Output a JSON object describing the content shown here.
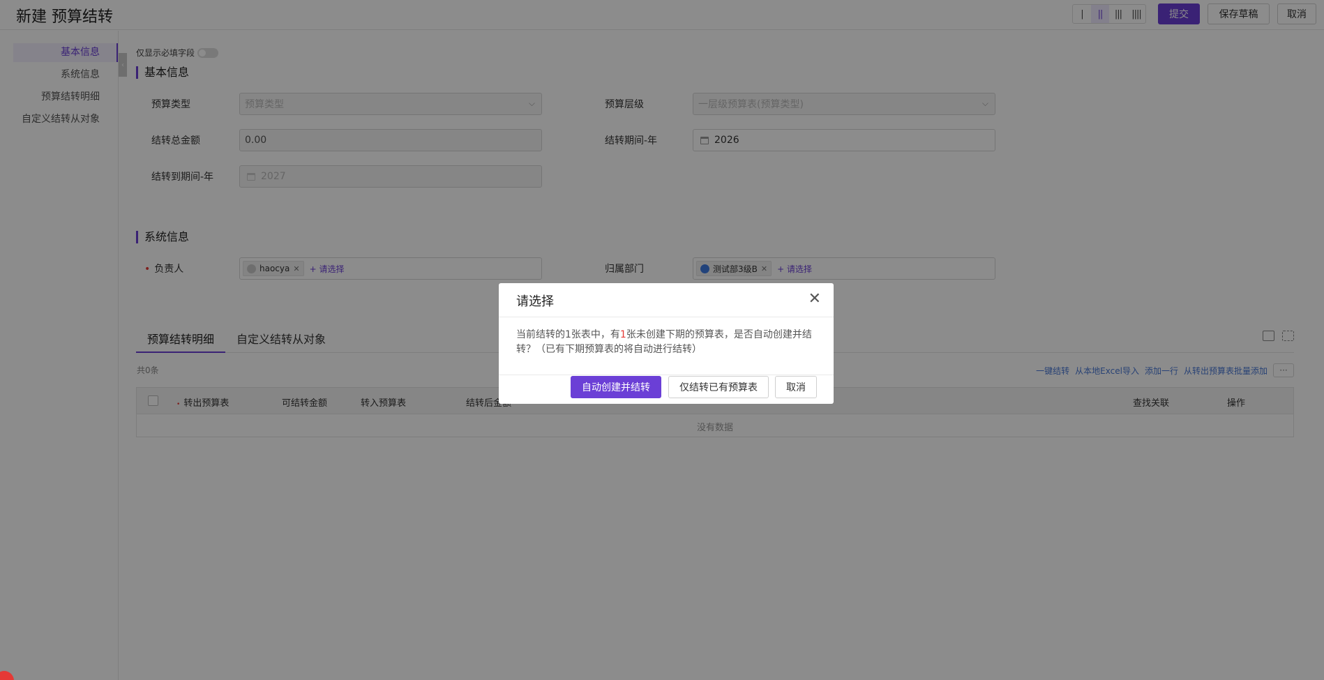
{
  "header": {
    "title": "新建 预算结转",
    "column_options": [
      "|",
      "||",
      "|||",
      "||||"
    ],
    "column_selected": "||",
    "submit_label": "提交",
    "save_draft_label": "保存草稿",
    "cancel_label": "取消"
  },
  "sidebar": {
    "items": [
      {
        "label": "基本信息",
        "active": true
      },
      {
        "label": "系统信息",
        "active": false
      },
      {
        "label": "预算结转明细",
        "active": false
      },
      {
        "label": "自定义结转从对象",
        "active": false
      }
    ],
    "collapse_icon": "chevron-left-icon"
  },
  "form": {
    "required_only_label": "仅显示必填字段",
    "basic_section_title": "基本信息",
    "budget_type": {
      "label": "预算类型",
      "placeholder": "预算类型"
    },
    "budget_level": {
      "label": "预算层级",
      "placeholder": "一层级预算表(预算类型)"
    },
    "total_amount": {
      "label": "结转总金额",
      "value": "0.00"
    },
    "period_year": {
      "label": "结转期间-年",
      "value": "2026"
    },
    "to_period_year": {
      "label": "结转到期间-年",
      "value": "2027"
    },
    "system_section_title": "系统信息",
    "owner": {
      "label": "负责人",
      "required_mark": "•",
      "chip": "haocya",
      "add_label": "+ 请选择"
    },
    "department": {
      "label": "归属部门",
      "chip": "测试部3级B",
      "add_label": "+ 请选择"
    }
  },
  "detail": {
    "tabs": [
      {
        "label": "预算结转明细",
        "active": true
      },
      {
        "label": "自定义结转从对象",
        "active": false
      }
    ],
    "count_text": "共0条",
    "actions": [
      "一键结转",
      "从本地Excel导入",
      "添加一行",
      "从转出预算表批量添加"
    ],
    "more_label": "···",
    "columns": [
      "转出预算表",
      "可结转金额",
      "转入预算表",
      "结转后金额",
      "查找关联",
      "操作"
    ],
    "empty_text": "没有数据"
  },
  "dialog": {
    "title": "请选择",
    "message_part1": "当前结转的1张表中，有",
    "message_highlight": "1",
    "message_part2": "张未创建下期的预算表，是否自动创建并结转？（已有下期预算表的将自动进行结转）",
    "confirm_label": "自动创建并结转",
    "existing_only_label": "仅结转已有预算表",
    "cancel_label": "取消",
    "close_icon": "close-icon"
  },
  "colors": {
    "accent": "#6b3fd6",
    "danger": "#e53935",
    "link": "#4a78d6"
  }
}
